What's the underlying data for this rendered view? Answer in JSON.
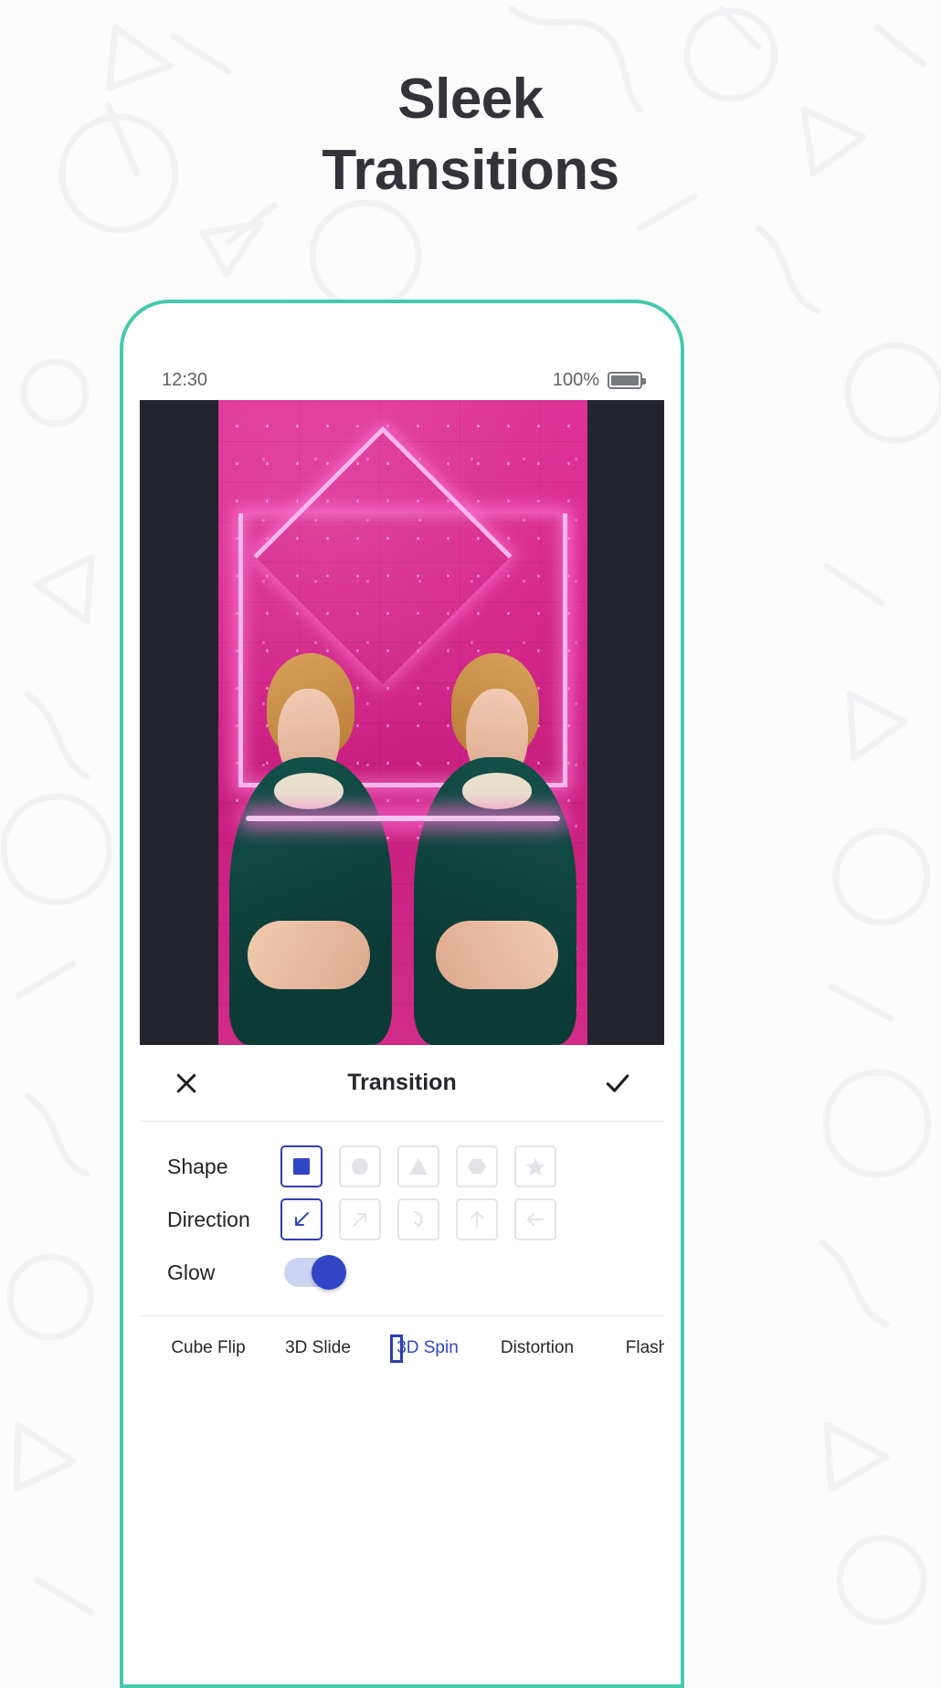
{
  "page": {
    "headline_line1": "Sleek",
    "headline_line2": "Transitions",
    "accent_frame_color": "#45c9ad",
    "accent_select_color": "#2c3fae",
    "headline_color": "#32343a"
  },
  "status_bar": {
    "time": "12:30",
    "battery_percent": "100%",
    "battery_icon": "battery-full-icon"
  },
  "editor": {
    "close_icon": "close-icon",
    "title": "Transition",
    "confirm_icon": "check-icon"
  },
  "controls": {
    "rows": [
      {
        "label": "Shape",
        "name": "shape",
        "options": [
          {
            "icon": "square-icon",
            "label": "Square",
            "selected": true
          },
          {
            "icon": "circle-icon",
            "label": "Circle",
            "selected": false
          },
          {
            "icon": "triangle-icon",
            "label": "Triangle",
            "selected": false
          },
          {
            "icon": "hexagon-icon",
            "label": "Hexagon",
            "selected": false
          },
          {
            "icon": "star-icon",
            "label": "Star",
            "selected": false
          }
        ]
      },
      {
        "label": "Direction",
        "name": "direction",
        "options": [
          {
            "icon": "arrow-down-left-icon",
            "label": "Down left",
            "selected": true
          },
          {
            "icon": "arrow-up-right-icon",
            "label": "Up right",
            "selected": false
          },
          {
            "icon": "arrow-curve-down-icon",
            "label": "Curve",
            "selected": false
          },
          {
            "icon": "arrow-up-icon",
            "label": "Up",
            "selected": false
          },
          {
            "icon": "arrow-left-icon",
            "label": "Left",
            "selected": false
          }
        ]
      }
    ],
    "glow": {
      "label": "Glow",
      "enabled": true
    }
  },
  "transitions": {
    "items": [
      {
        "label": "Cube Flip",
        "selected": false,
        "thumb_style": "blue"
      },
      {
        "label": "3D Slide",
        "selected": false,
        "thumb_style": "yellow"
      },
      {
        "label": "3D Spin",
        "selected": true,
        "thumb_style": "blue"
      },
      {
        "label": "Distortion",
        "selected": false,
        "thumb_style": "yellow"
      },
      {
        "label": "Flash",
        "selected": false,
        "thumb_style": "yellow"
      },
      {
        "label": "",
        "selected": false,
        "thumb_style": "yellow"
      }
    ]
  }
}
